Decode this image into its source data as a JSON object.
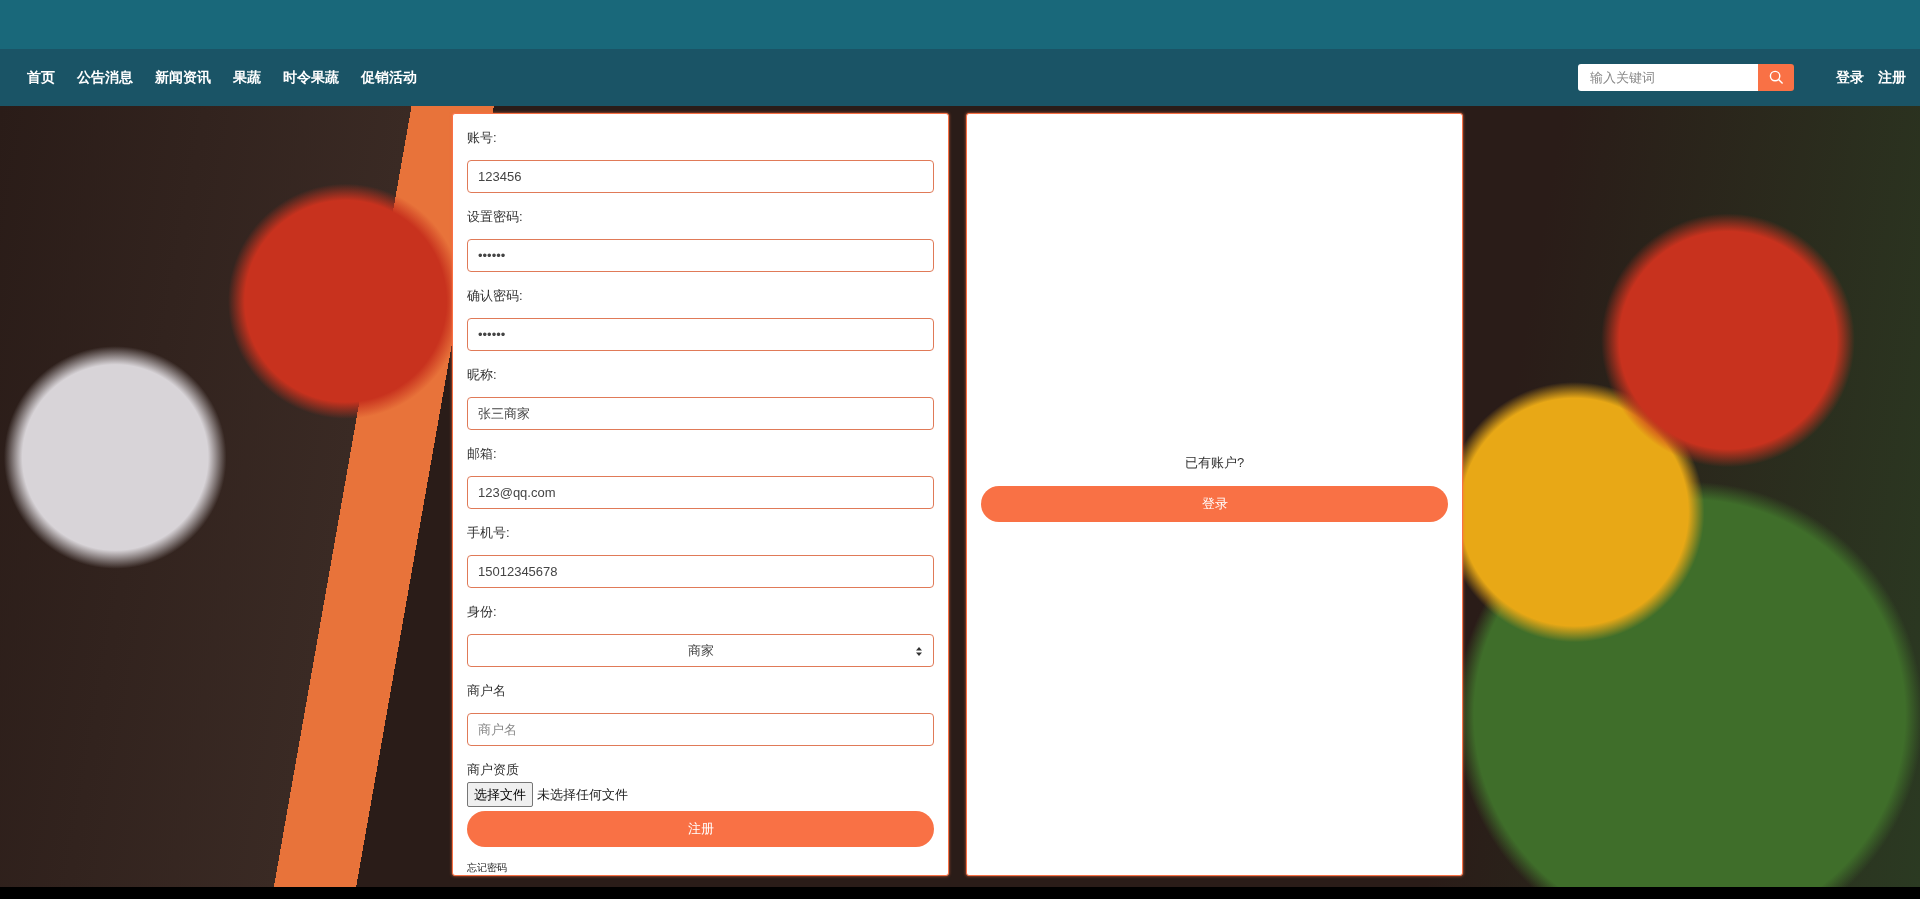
{
  "nav": {
    "items": [
      {
        "label": "首页"
      },
      {
        "label": "公告消息"
      },
      {
        "label": "新闻资讯"
      },
      {
        "label": "果蔬"
      },
      {
        "label": "时令果蔬"
      },
      {
        "label": "促销活动"
      }
    ],
    "search": {
      "placeholder": "输入关键词"
    },
    "links": [
      {
        "label": "登录"
      },
      {
        "label": "注册"
      }
    ]
  },
  "register": {
    "fields": [
      {
        "kind": "text",
        "label": "账号:",
        "value": "123456"
      },
      {
        "kind": "text",
        "label": "设置密码:",
        "value": "••••••"
      },
      {
        "kind": "text",
        "label": "确认密码:",
        "value": "••••••"
      },
      {
        "kind": "text",
        "label": "昵称:",
        "value": "张三商家"
      },
      {
        "kind": "text",
        "label": "邮箱:",
        "value": "123@qq.com"
      },
      {
        "kind": "text",
        "label": "手机号:",
        "value": "15012345678"
      },
      {
        "kind": "select",
        "label": "身份:",
        "value": "商家"
      },
      {
        "kind": "text",
        "label": "商户名",
        "placeholder": "商户名"
      },
      {
        "kind": "file",
        "label": "商户资质",
        "button": "选择文件",
        "status": "未选择任何文件"
      }
    ],
    "submit": "注册",
    "forgot": "忘记密码"
  },
  "login": {
    "prompt": "已有账户?",
    "button": "登录"
  }
}
